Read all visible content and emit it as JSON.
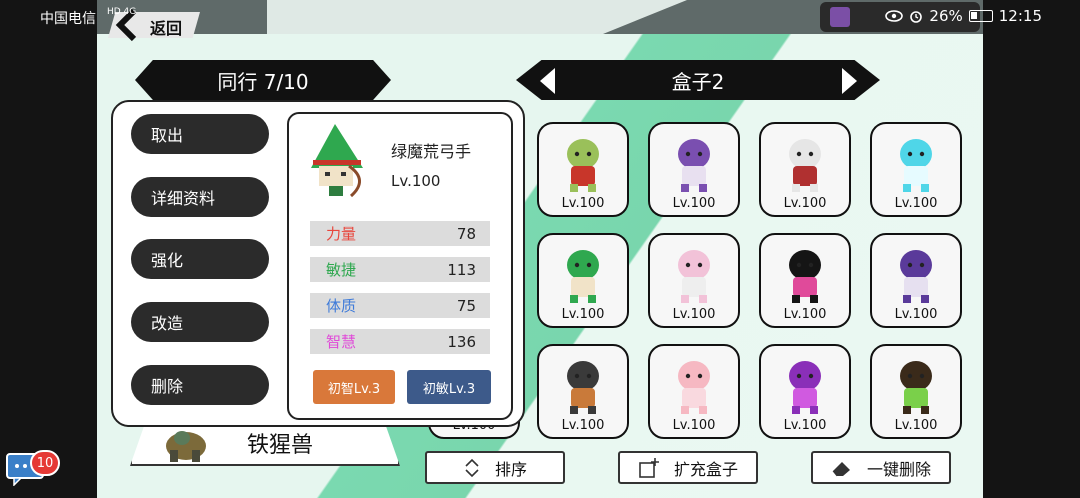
{
  "status_bar": {
    "carrier": "中国电信",
    "network_top": "HD 4G",
    "battery": "26%",
    "time": "12:15"
  },
  "back": {
    "label": "返回"
  },
  "team_header": {
    "label": "同行 7/10"
  },
  "box_header": {
    "label": "盒子2"
  },
  "grid": [
    {
      "level": "Lv.100",
      "icon": "goblin-mace-icon"
    },
    {
      "level": "Lv.100",
      "icon": "purple-wizard-icon"
    },
    {
      "level": "Lv.100",
      "icon": "white-hair-swordsman-icon"
    },
    {
      "level": "Lv.100",
      "icon": "ice-spirit-icon"
    },
    {
      "level": "Lv.100",
      "icon": "green-goblin-archer-icon"
    },
    {
      "level": "Lv.100",
      "icon": "skull-pink-brute-icon"
    },
    {
      "level": "Lv.100",
      "icon": "black-feather-witch-icon"
    },
    {
      "level": "Lv.100",
      "icon": "purple-reaper-icon"
    },
    {
      "level": "Lv.100",
      "icon": "dark-samurai-icon"
    },
    {
      "level": "Lv.100",
      "icon": "pink-pig-icon"
    },
    {
      "level": "Lv.100",
      "icon": "purple-cube-robot-icon"
    },
    {
      "level": "Lv.100",
      "icon": "green-fairy-icon"
    }
  ],
  "popup": {
    "actions": [
      "取出",
      "详细资料",
      "强化",
      "改造",
      "删除"
    ],
    "name": "绿魔荒弓手",
    "level": "Lv.100",
    "stats": [
      {
        "label": "力量",
        "value": "78",
        "color": "#e8463c"
      },
      {
        "label": "敏捷",
        "value": "113",
        "color": "#2fa84f"
      },
      {
        "label": "体质",
        "value": "75",
        "color": "#3f7bd9"
      },
      {
        "label": "智慧",
        "value": "136",
        "color": "#e04ad8"
      }
    ],
    "skills": [
      {
        "label": "初智Lv.3",
        "color": "#d9783a"
      },
      {
        "label": "初敏Lv.3",
        "color": "#3d5a8a"
      }
    ]
  },
  "hidden_level": "Lv.100",
  "selected_beast": {
    "label": "铁猩兽"
  },
  "bottom_buttons": {
    "sort": "排序",
    "expand": "扩充盒子",
    "delete_all": "一键删除"
  },
  "chat": {
    "badge": "10"
  }
}
